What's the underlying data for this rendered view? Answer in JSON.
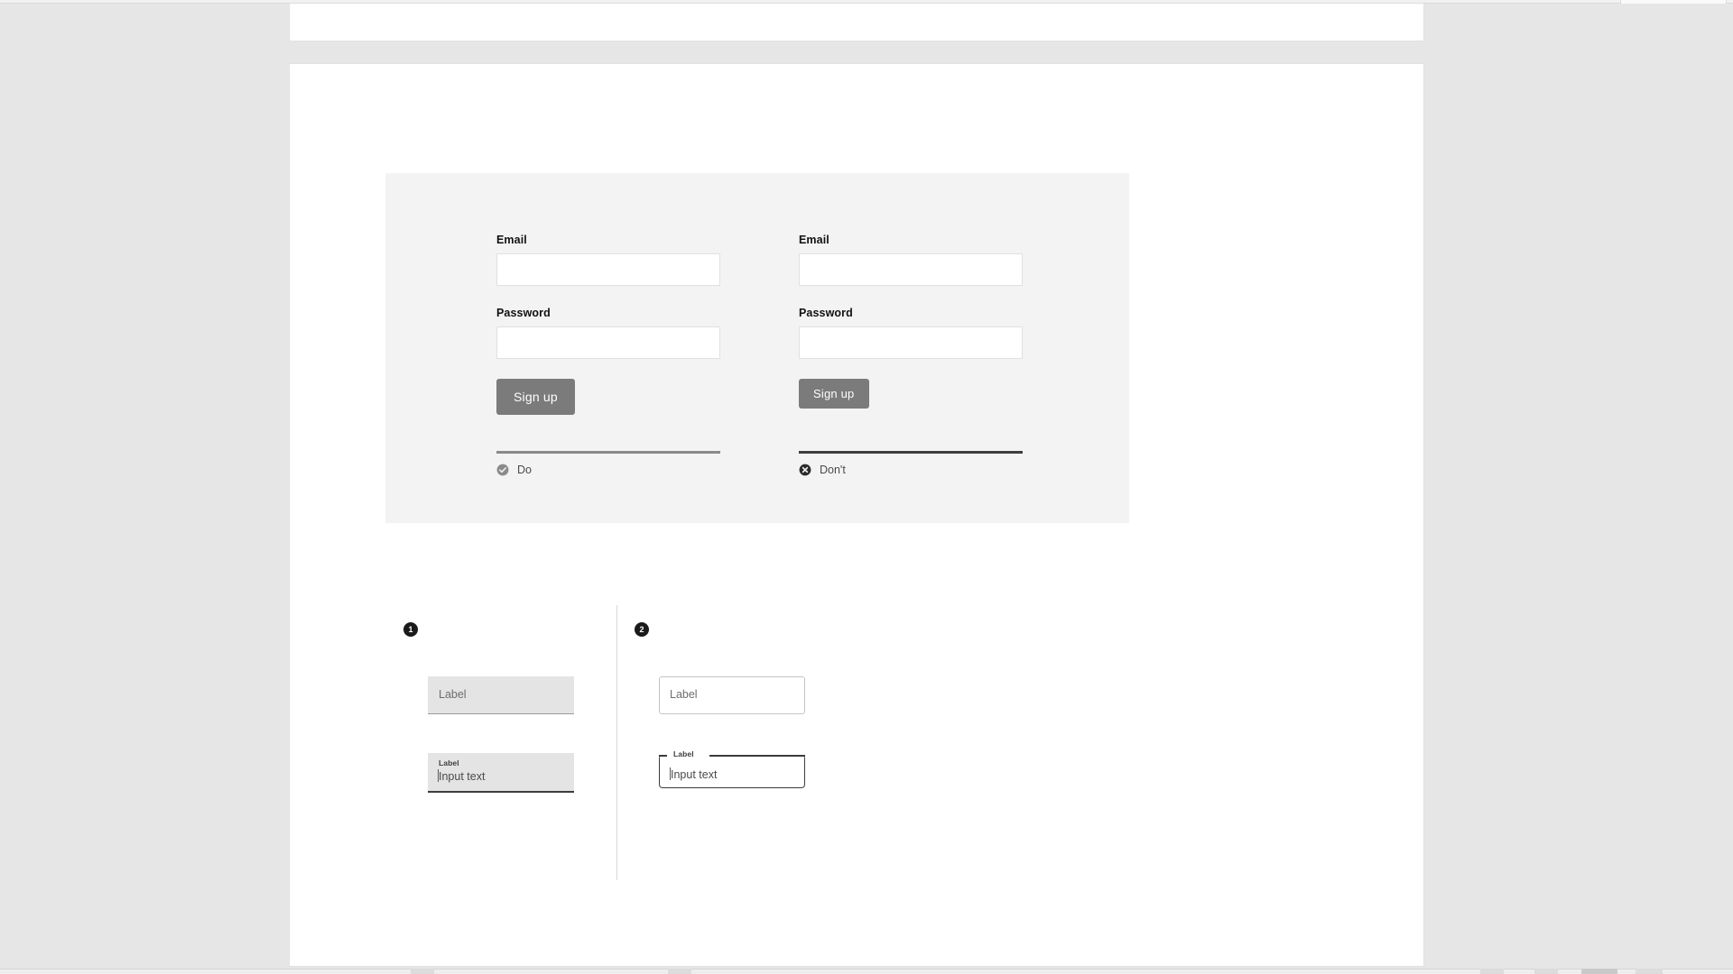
{
  "page": {
    "background_color": "#e6e6e6",
    "card_color": "#ffffff"
  },
  "compare_panel": {
    "background_color": "#f3f3f3",
    "columns": [
      {
        "id": "do",
        "verdict_label": "Do",
        "verdict_icon": "check-circle-icon",
        "verdict_icon_color": "#8a8a8a",
        "rule_color": "#8a8a8a",
        "fields": [
          {
            "label": "Email",
            "value": "",
            "placeholder": ""
          },
          {
            "label": "Password",
            "value": "",
            "placeholder": ""
          }
        ],
        "submit_label": "Sign up",
        "submit_color": "#7b7b7b"
      },
      {
        "id": "dont",
        "verdict_label": "Don't",
        "verdict_icon": "x-circle-icon",
        "verdict_icon_color": "#2b2b2b",
        "rule_color": "#3d3d3d",
        "fields": [
          {
            "label": "Email",
            "value": "",
            "placeholder": ""
          },
          {
            "label": "Password",
            "value": "",
            "placeholder": ""
          }
        ],
        "submit_label": "Sign up",
        "submit_color": "#7b7b7b"
      }
    ]
  },
  "variants": {
    "divider_color": "#d9d9d9",
    "columns": [
      {
        "badge": "1",
        "style": "filled",
        "empty_field": {
          "placeholder": "Label",
          "underline_color": "#9a9a9a",
          "fill_color": "#e4e4e4"
        },
        "filled_field": {
          "label": "Label",
          "value": "Input text",
          "underline_color": "#3c3c3c",
          "fill_color": "#e4e4e4"
        }
      },
      {
        "badge": "2",
        "style": "outlined",
        "empty_field": {
          "placeholder": "Label",
          "border_color": "#c4c4c4"
        },
        "filled_field": {
          "label": "Label",
          "value": "Input text",
          "border_color": "#3c3c3c"
        }
      }
    ]
  }
}
